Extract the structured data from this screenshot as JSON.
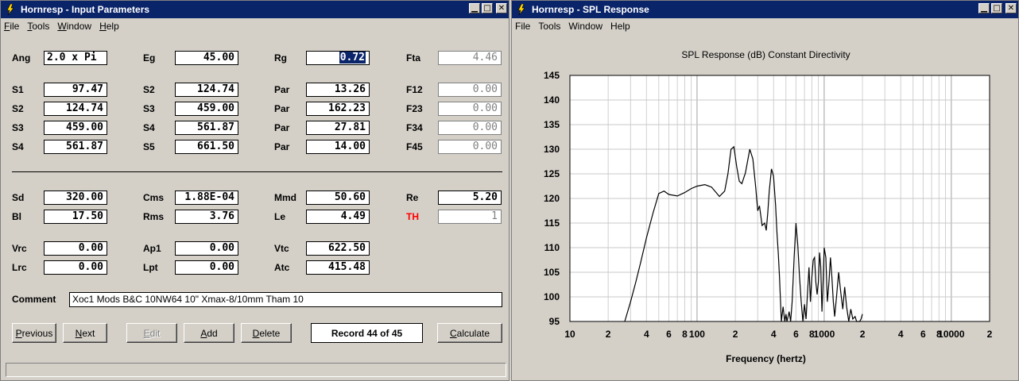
{
  "input_window": {
    "title": "Hornresp - Input Parameters",
    "menu": [
      {
        "u": "F",
        "rest": "ile"
      },
      {
        "u": "T",
        "rest": "ools"
      },
      {
        "u": "W",
        "rest": "indow"
      },
      {
        "u": "H",
        "rest": "elp"
      }
    ],
    "params": {
      "ang": {
        "label": "Ang",
        "value": "2.0 x Pi"
      },
      "eg": {
        "label": "Eg",
        "value": "45.00"
      },
      "rg": {
        "label": "Rg",
        "value": "0.72"
      },
      "fta": {
        "label": "Fta",
        "value": "4.46"
      },
      "s1a": {
        "label": "S1",
        "value": "97.47"
      },
      "s2a": {
        "label": "S2",
        "value": "124.74"
      },
      "par1": {
        "label": "Par",
        "value": "13.26"
      },
      "f12": {
        "label": "F12",
        "value": "0.00"
      },
      "s2b": {
        "label": "S2",
        "value": "124.74"
      },
      "s3a": {
        "label": "S3",
        "value": "459.00"
      },
      "par2": {
        "label": "Par",
        "value": "162.23"
      },
      "f23": {
        "label": "F23",
        "value": "0.00"
      },
      "s3b": {
        "label": "S3",
        "value": "459.00"
      },
      "s4a": {
        "label": "S4",
        "value": "561.87"
      },
      "par3": {
        "label": "Par",
        "value": "27.81"
      },
      "f34": {
        "label": "F34",
        "value": "0.00"
      },
      "s4b": {
        "label": "S4",
        "value": "561.87"
      },
      "s5": {
        "label": "S5",
        "value": "661.50"
      },
      "par4": {
        "label": "Par",
        "value": "14.00"
      },
      "f45": {
        "label": "F45",
        "value": "0.00"
      },
      "sd": {
        "label": "Sd",
        "value": "320.00"
      },
      "cms": {
        "label": "Cms",
        "value": "1.88E-04"
      },
      "mmd": {
        "label": "Mmd",
        "value": "50.60"
      },
      "re": {
        "label": "Re",
        "value": "5.20"
      },
      "bl": {
        "label": "Bl",
        "value": "17.50"
      },
      "rms": {
        "label": "Rms",
        "value": "3.76"
      },
      "le": {
        "label": "Le",
        "value": "4.49"
      },
      "th": {
        "label": "TH",
        "value": "1"
      },
      "vrc": {
        "label": "Vrc",
        "value": "0.00"
      },
      "ap1": {
        "label": "Ap1",
        "value": "0.00"
      },
      "vtc": {
        "label": "Vtc",
        "value": "622.50"
      },
      "lrc": {
        "label": "Lrc",
        "value": "0.00"
      },
      "lpt": {
        "label": "Lpt",
        "value": "0.00"
      },
      "atc": {
        "label": "Atc",
        "value": "415.48"
      }
    },
    "comment": {
      "label": "Comment",
      "value": "Xoc1 Mods B&C 10NW64 10\"  Xmax-8/10mm  Tham 10"
    },
    "buttons": {
      "previous": {
        "u": "P",
        "rest": "revious"
      },
      "next": {
        "u": "N",
        "rest": "ext"
      },
      "edit": {
        "u": "E",
        "rest": "dit"
      },
      "add": {
        "u": "A",
        "rest": "dd"
      },
      "delete": {
        "u": "D",
        "rest": "elete"
      },
      "calculate": {
        "u": "C",
        "rest": "alculate"
      }
    },
    "record": "Record 44 of 45"
  },
  "spl_window": {
    "title": "Hornresp - SPL Response",
    "menu": [
      "File",
      "Tools",
      "Window",
      "Help"
    ]
  },
  "chart_data": {
    "type": "line",
    "title": "SPL Response (dB)   Constant Directivity",
    "xlabel": "Frequency (hertz)",
    "ylabel": "",
    "x_scale": "log",
    "xlim": [
      10,
      20000
    ],
    "ylim": [
      95,
      145
    ],
    "grid": true,
    "y_ticks": [
      145,
      140,
      135,
      130,
      125,
      120,
      115,
      110,
      105,
      100,
      95
    ],
    "x_ticks": [
      {
        "value": 10,
        "label": "10"
      },
      {
        "value": 20,
        "label": "2"
      },
      {
        "value": 40,
        "label": "4"
      },
      {
        "value": 60,
        "label": "6"
      },
      {
        "value": 80,
        "label": "8"
      },
      {
        "value": 100,
        "label": "100"
      },
      {
        "value": 200,
        "label": "2"
      },
      {
        "value": 400,
        "label": "4"
      },
      {
        "value": 600,
        "label": "6"
      },
      {
        "value": 800,
        "label": "8"
      },
      {
        "value": 1000,
        "label": "1000"
      },
      {
        "value": 2000,
        "label": "2"
      },
      {
        "value": 4000,
        "label": "4"
      },
      {
        "value": 6000,
        "label": "6"
      },
      {
        "value": 8000,
        "label": "8"
      },
      {
        "value": 10000,
        "label": "10000"
      },
      {
        "value": 20000,
        "label": "2"
      }
    ],
    "series": [
      {
        "color": "#000000",
        "x": [
          27,
          30,
          33,
          36,
          40,
          45,
          50,
          55,
          60,
          70,
          80,
          90,
          100,
          115,
          130,
          150,
          165,
          175,
          185,
          195,
          205,
          215,
          225,
          240,
          260,
          275,
          290,
          300,
          310,
          325,
          340,
          350,
          360,
          370,
          385,
          400,
          415,
          425,
          435,
          445,
          460,
          475,
          490,
          500,
          510,
          520,
          530,
          545,
          560,
          580,
          600,
          620,
          640,
          660,
          680,
          700,
          720,
          740,
          760,
          780,
          800,
          820,
          840,
          860,
          880,
          900,
          920,
          940,
          960,
          980,
          1000,
          1030,
          1060,
          1090,
          1120,
          1150,
          1180,
          1210,
          1250,
          1300,
          1350,
          1400,
          1450,
          1500,
          1560,
          1620,
          1680,
          1750,
          1800,
          1850,
          1900,
          1950,
          2000
        ],
        "y": [
          95,
          99,
          103,
          107,
          112,
          117,
          121,
          121.5,
          120.8,
          120.5,
          121.2,
          122,
          122.5,
          122.8,
          122.3,
          120.4,
          121.5,
          125,
          130,
          130.5,
          126.5,
          123.5,
          123,
          125.2,
          130,
          128,
          122,
          117.5,
          118.5,
          114.5,
          115,
          113.5,
          117,
          121.5,
          126,
          124.5,
          118.5,
          113,
          109,
          104,
          95,
          98,
          95,
          96.5,
          95,
          96,
          97,
          95,
          99,
          108,
          115,
          110.5,
          104,
          99,
          95,
          98.5,
          95.5,
          101,
          106,
          99,
          104,
          107.5,
          108,
          103,
          100.5,
          103,
          109,
          106,
          97,
          103,
          110,
          108,
          99,
          103,
          108,
          104,
          99,
          96,
          100,
          105,
          101,
          97.5,
          102,
          98,
          95,
          97.5,
          95.5,
          96,
          95,
          95,
          95,
          95.5,
          96.5
        ]
      }
    ]
  }
}
